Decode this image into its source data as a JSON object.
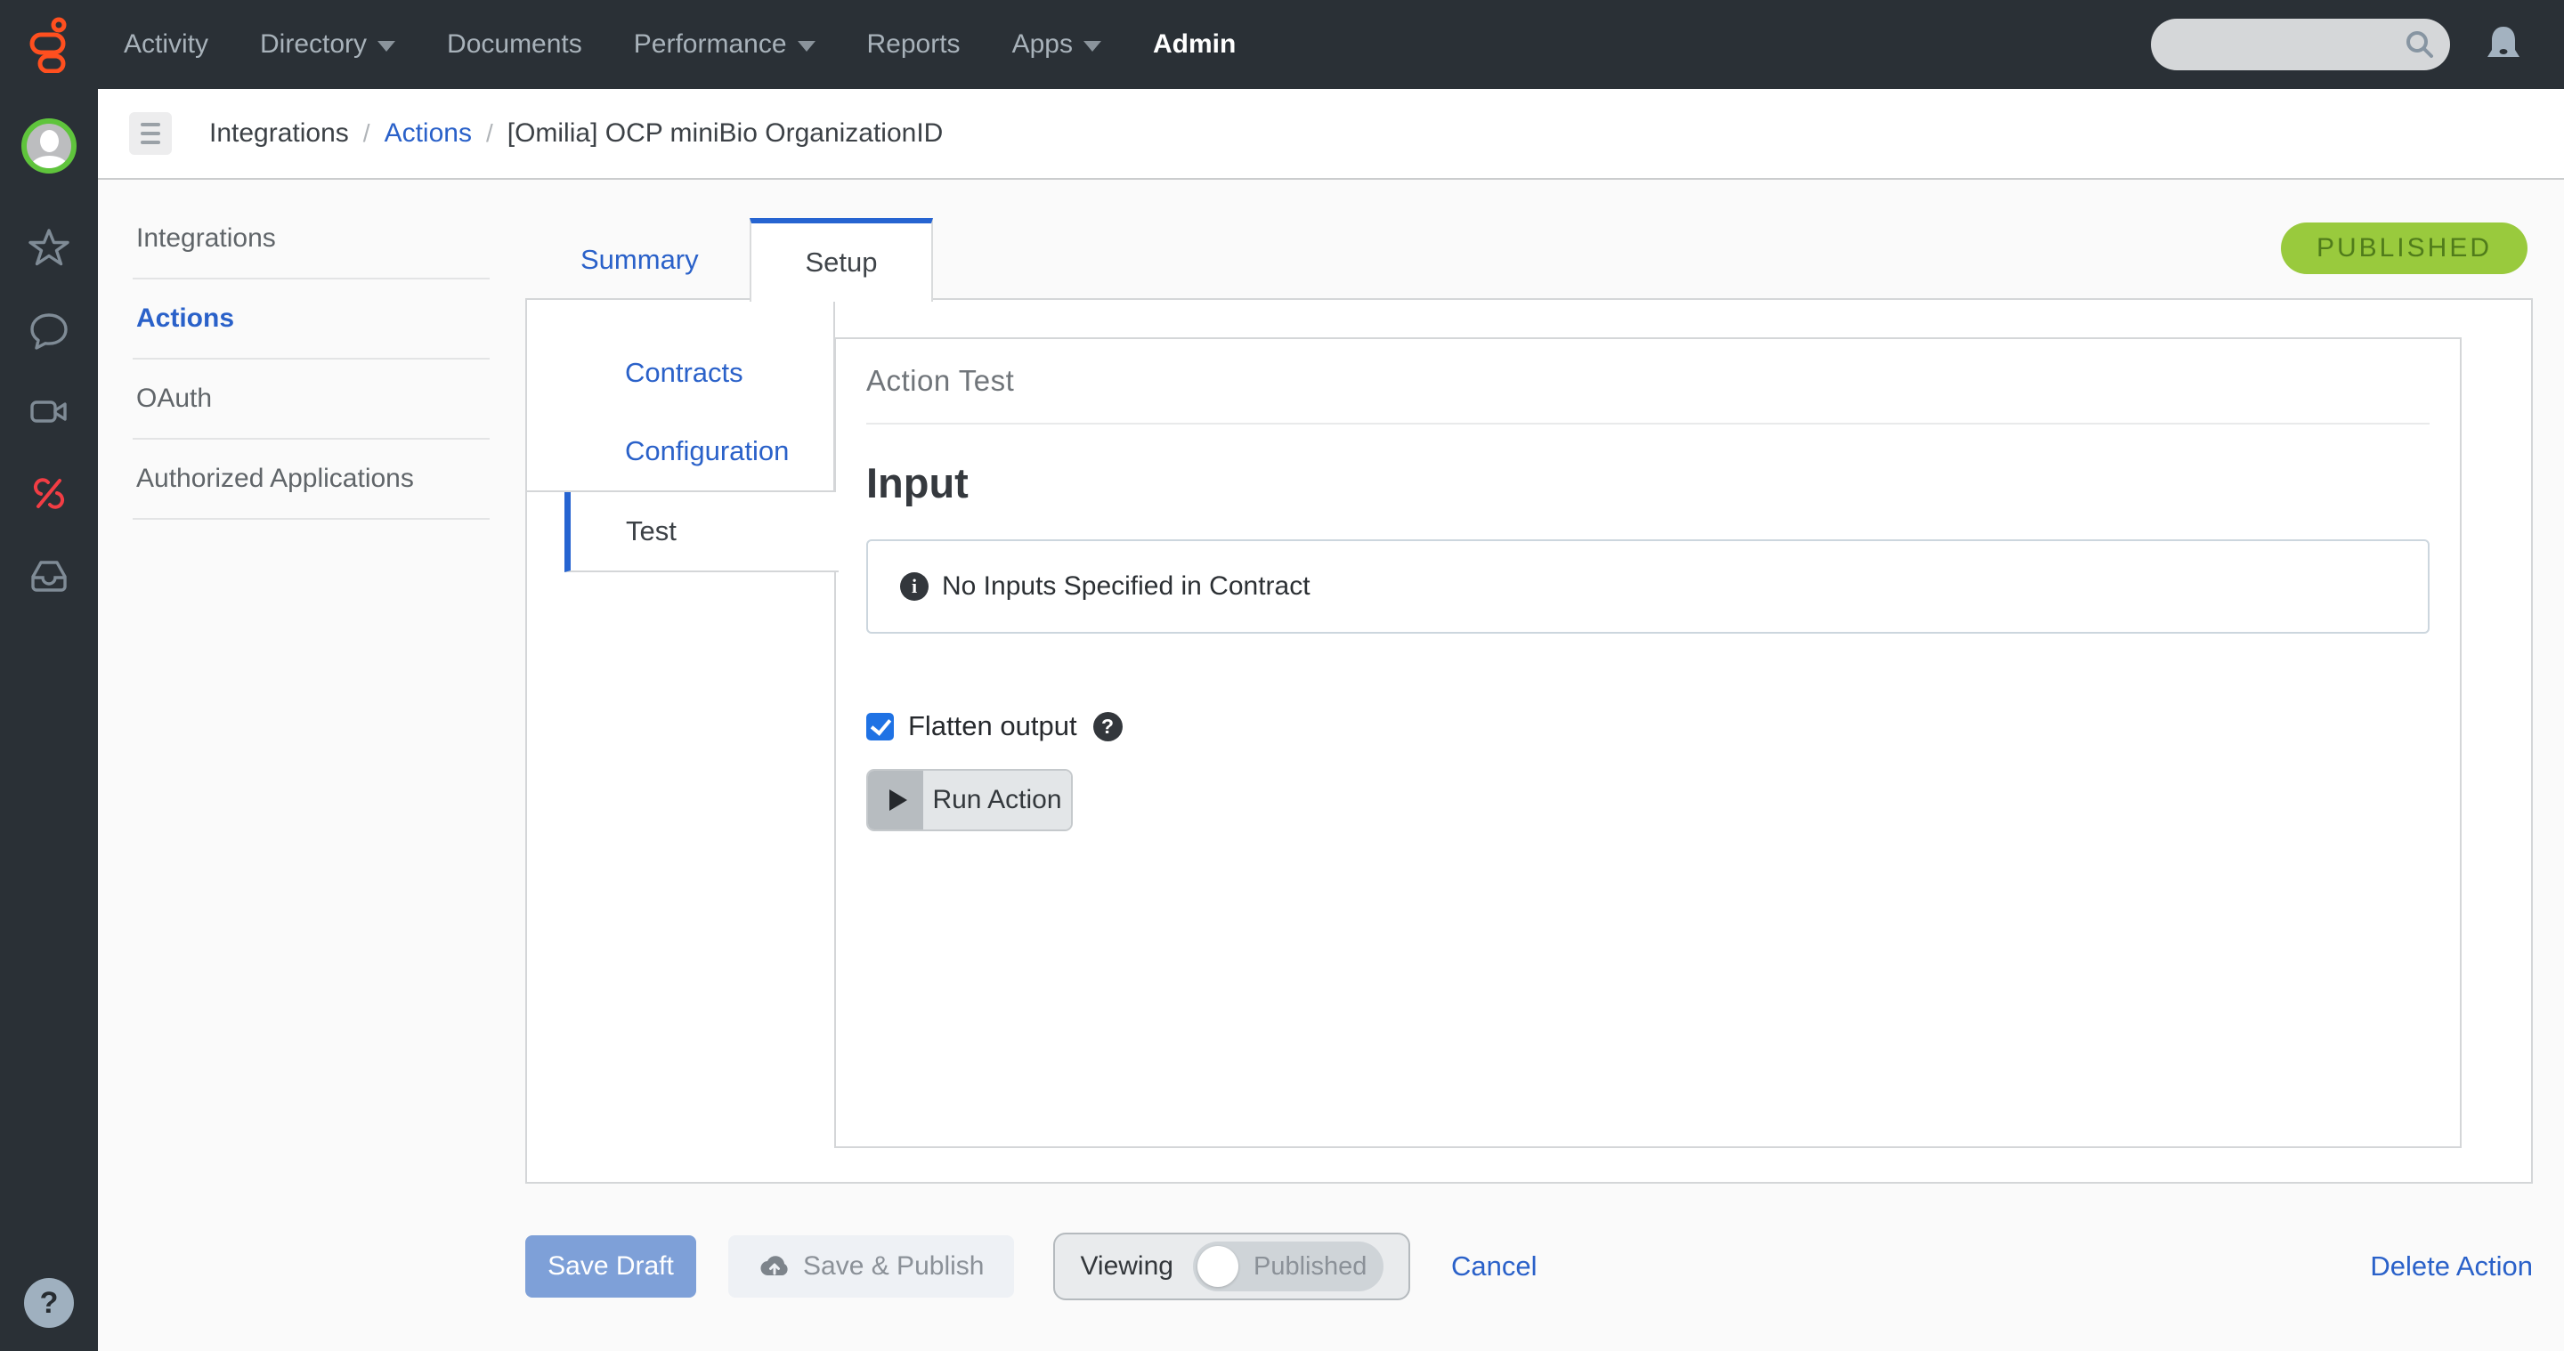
{
  "topnav": {
    "items": [
      {
        "label": "Activity",
        "caret": false
      },
      {
        "label": "Directory",
        "caret": true
      },
      {
        "label": "Documents",
        "caret": false
      },
      {
        "label": "Performance",
        "caret": true
      },
      {
        "label": "Reports",
        "caret": false
      },
      {
        "label": "Apps",
        "caret": true
      },
      {
        "label": "Admin",
        "caret": false,
        "active": true
      }
    ],
    "search": {
      "value": "",
      "placeholder": ""
    }
  },
  "sidebar": {
    "icons": [
      "user-avatar",
      "star",
      "chat",
      "video",
      "phone-disabled",
      "inbox",
      "help"
    ]
  },
  "breadcrumb": {
    "items": [
      "Integrations",
      "Actions",
      "[Omilia] OCP miniBio OrganizationID"
    ]
  },
  "leftnav": {
    "items": [
      {
        "label": "Integrations",
        "active": false
      },
      {
        "label": "Actions",
        "active": true
      },
      {
        "label": "OAuth",
        "active": false
      },
      {
        "label": "Authorized Applications",
        "active": false
      }
    ]
  },
  "tabs": {
    "summary": "Summary",
    "setup": "Setup"
  },
  "status_badge": {
    "label": "PUBLISHED"
  },
  "setup_nav": {
    "items": [
      {
        "label": "Contracts",
        "active": false
      },
      {
        "label": "Configuration",
        "active": false
      },
      {
        "label": "Test",
        "active": true
      }
    ]
  },
  "test_panel": {
    "title": "Action Test",
    "input_heading": "Input",
    "info_message": "No Inputs Specified in Contract",
    "flatten_label": "Flatten output",
    "flatten_checked": true,
    "run_action_label": "Run Action"
  },
  "footer": {
    "save_draft": "Save Draft",
    "save_publish": "Save & Publish",
    "viewing_label": "Viewing",
    "viewing_state": "Published",
    "cancel": "Cancel",
    "delete_action": "Delete Action"
  },
  "icons": {
    "info_glyph": "i",
    "help_glyph": "?",
    "sidebar_help_glyph": "?"
  },
  "colors": {
    "brand_orange": "#ff4f1f",
    "nav_dark": "#2a3036",
    "accent_blue": "#2a61c9",
    "tab_accent_blue": "#2664d1",
    "badge_bg": "#99ca3d",
    "badge_fg": "#507c1b",
    "checkbox_blue": "#1f72e4",
    "save_draft_bg": "#7ea0d8",
    "phone_disabled_red": "#f23d44"
  }
}
